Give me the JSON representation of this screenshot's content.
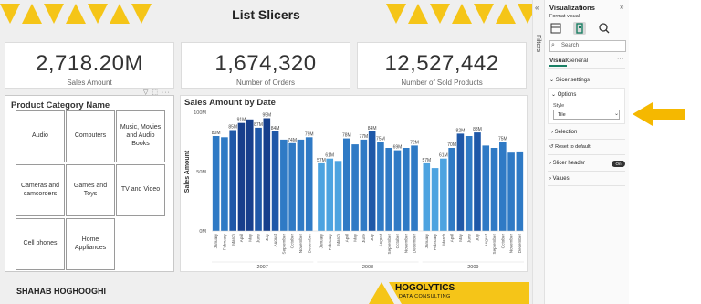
{
  "page": {
    "title": "List Slicers",
    "author": "SHAHAB HOGHOOGHI",
    "brand": "HOGOLYTICS",
    "brand_sub": "DATA CONSULTING"
  },
  "cards": [
    {
      "value": "2,718.20M",
      "label": "Sales Amount"
    },
    {
      "value": "1,674,320",
      "label": "Number of Orders"
    },
    {
      "value": "12,527,442",
      "label": "Number of Sold Products"
    }
  ],
  "slicer": {
    "title": "Product Category Name",
    "toolbar": "▽ ⬚ ···",
    "tiles": [
      "Audio",
      "Computers",
      "Music, Movies and Audio Books",
      "Cameras and camcorders",
      "Games and Toys",
      "TV and Video",
      "Cell phones",
      "Home Appliances"
    ]
  },
  "chart_data": {
    "type": "bar",
    "title": "Sales Amount by Date",
    "ylabel": "Sales Amount",
    "ylim": [
      0,
      100
    ],
    "yticks": [
      "0M",
      "50M",
      "100M"
    ],
    "months": [
      "January",
      "February",
      "March",
      "April",
      "May",
      "June",
      "July",
      "August",
      "September",
      "October",
      "November",
      "December"
    ],
    "series": [
      {
        "year": "2007",
        "values": [
          80,
          79,
          85,
          91,
          94,
          87,
          95,
          84,
          77,
          74,
          77,
          79
        ],
        "labels": [
          "80M",
          "",
          "85M",
          "91M",
          "",
          "87M",
          "95M",
          "84M",
          "",
          "74M",
          "",
          "79M"
        ]
      },
      {
        "year": "2008",
        "values": [
          57,
          61,
          59,
          78,
          73,
          77,
          84,
          75,
          70,
          68,
          70,
          72
        ],
        "labels": [
          "57M",
          "61M",
          "",
          "78M",
          "",
          "77M",
          "84M",
          "75M",
          "",
          "69M",
          "",
          "72M"
        ]
      },
      {
        "year": "2009",
        "values": [
          57,
          53,
          61,
          70,
          82,
          80,
          83,
          72,
          70,
          75,
          66,
          67
        ],
        "labels": [
          "57M",
          "",
          "61M",
          "70M",
          "82M",
          "",
          "83M",
          "",
          "",
          "75M",
          "",
          ""
        ]
      }
    ],
    "colors": {
      "bar_light": "#4da3e0",
      "bar_mid": "#2f7ac5",
      "bar_dark": "#173f8c"
    }
  },
  "filters_pane": {
    "label": "Filters",
    "chevron": "«"
  },
  "viz_pane": {
    "title": "Visualizations",
    "collapse": "»",
    "format_label": "Format visual",
    "search_placeholder": "Search",
    "tabs": {
      "visual": "Visual",
      "general": "General",
      "more": "···"
    },
    "slicer_settings": "Slicer settings",
    "options": "Options",
    "style_label": "Style",
    "style_value": "Tile",
    "selection": "Selection",
    "reset": "Reset to default",
    "slicer_header": "Slicer header",
    "slicer_header_toggle": "On",
    "values": "Values"
  },
  "colors": {
    "accent": "#f5c518",
    "pointer": "#f5b800"
  }
}
